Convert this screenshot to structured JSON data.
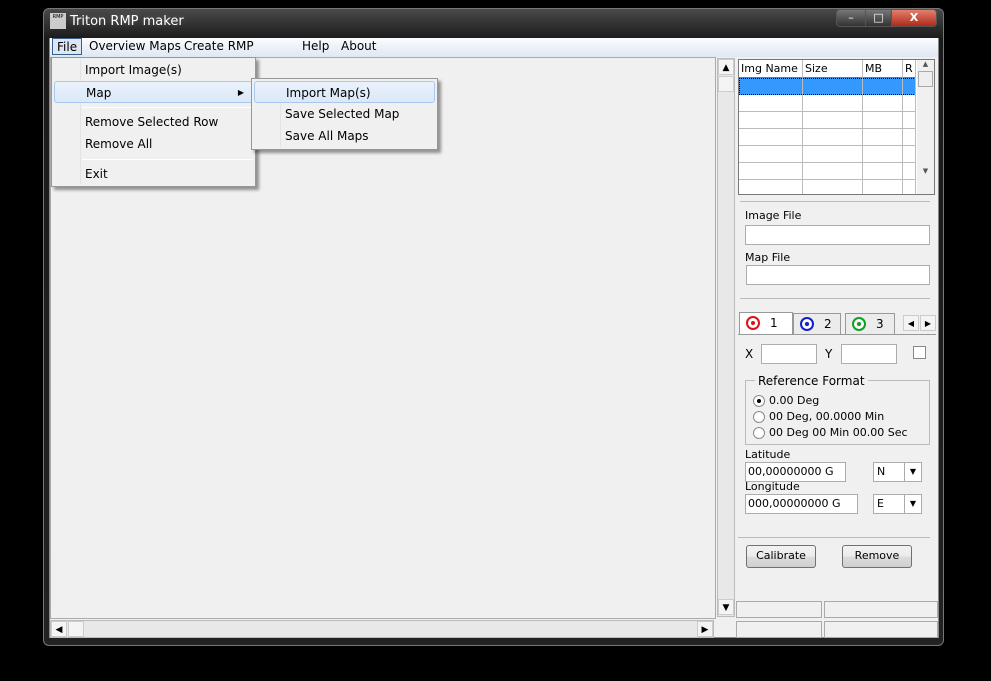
{
  "window": {
    "title": "Triton RMP maker",
    "icon_text": "RMP",
    "minimize": "–",
    "maximize": "□",
    "close": "X"
  },
  "menubar": [
    "File",
    "Overview Maps",
    "Create RMP",
    "Help",
    "About"
  ],
  "file_menu": {
    "items": [
      "Import Image(s)",
      "Map",
      "Remove Selected Row",
      "Remove All",
      "Exit"
    ]
  },
  "map_submenu": {
    "items": [
      "Import Map(s)",
      "Save Selected Map",
      "Save All Maps"
    ]
  },
  "grid": {
    "columns": [
      "Img Name",
      "Size",
      "MB",
      "R"
    ],
    "rows": 7
  },
  "fields": {
    "image_file_label": "Image File",
    "image_file": "",
    "map_file_label": "Map File",
    "map_file": ""
  },
  "tabs": [
    "1",
    "2",
    "3"
  ],
  "tab_colors": [
    "#e0101a",
    "#1020d0",
    "#10a020"
  ],
  "coords": {
    "x_label": "X",
    "x": "",
    "y_label": "Y",
    "y": ""
  },
  "reference_format": {
    "title": "Reference Format",
    "options": [
      "0.00 Deg",
      "00 Deg, 00.0000 Min",
      "00 Deg 00 Min 00.00 Sec"
    ],
    "selected": 0
  },
  "latitude": {
    "label": "Latitude",
    "value": "00,00000000 G",
    "hemisphere": "N"
  },
  "longitude": {
    "label": "Longitude",
    "value": "000,00000000 G",
    "hemisphere": "E"
  },
  "buttons": {
    "calibrate": "Calibrate",
    "remove": "Remove"
  }
}
